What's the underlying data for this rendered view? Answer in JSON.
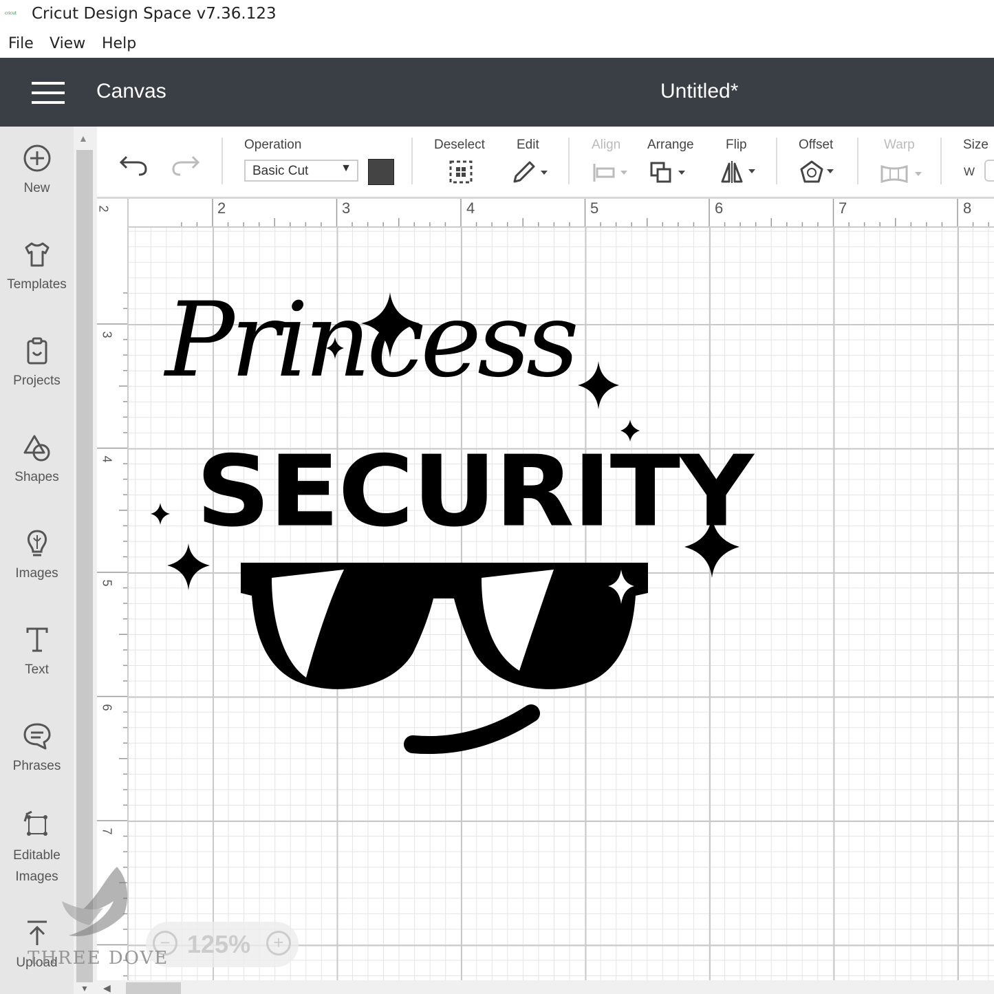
{
  "app": {
    "title": "Cricut Design Space  v7.36.123",
    "logo_text": "cricut"
  },
  "menu": [
    "File",
    "View",
    "Help"
  ],
  "header": {
    "section": "Canvas",
    "document_title": "Untitled*"
  },
  "sidebar": {
    "items": [
      {
        "label": "New",
        "icon": "plus-circle-icon"
      },
      {
        "label": "Templates",
        "icon": "tshirt-icon"
      },
      {
        "label": "Projects",
        "icon": "projects-icon"
      },
      {
        "label": "Shapes",
        "icon": "shapes-icon"
      },
      {
        "label": "Images",
        "icon": "lightbulb-icon"
      },
      {
        "label": "Text",
        "icon": "text-icon"
      },
      {
        "label": "Phrases",
        "icon": "speech-bubble-icon"
      },
      {
        "label": "Editable",
        "label2": "Images",
        "icon": "editable-images-icon"
      },
      {
        "label": "Upload",
        "icon": "upload-icon"
      }
    ]
  },
  "toolbar": {
    "operation_label": "Operation",
    "operation_value": "Basic Cut",
    "deselect_label": "Deselect",
    "edit_label": "Edit",
    "align_label": "Align",
    "arrange_label": "Arrange",
    "flip_label": "Flip",
    "offset_label": "Offset",
    "warp_label": "Warp",
    "size_label": "Size",
    "size_w": "W",
    "color": "#444444"
  },
  "ruler": {
    "horizontal": [
      "2",
      "2",
      "3",
      "4",
      "5",
      "6",
      "7",
      "8"
    ],
    "vertical": [
      "3",
      "4",
      "5",
      "6",
      "7"
    ]
  },
  "design": {
    "line1": "Princess",
    "line2": "SECURITY"
  },
  "zoom": {
    "minus": "−",
    "level": "125%",
    "plus": "+"
  },
  "watermark": "THREE DOVE",
  "colors": {
    "header_bg": "#3a3f45",
    "sidebar_bg": "#e6e6e6",
    "design": "#000000"
  }
}
